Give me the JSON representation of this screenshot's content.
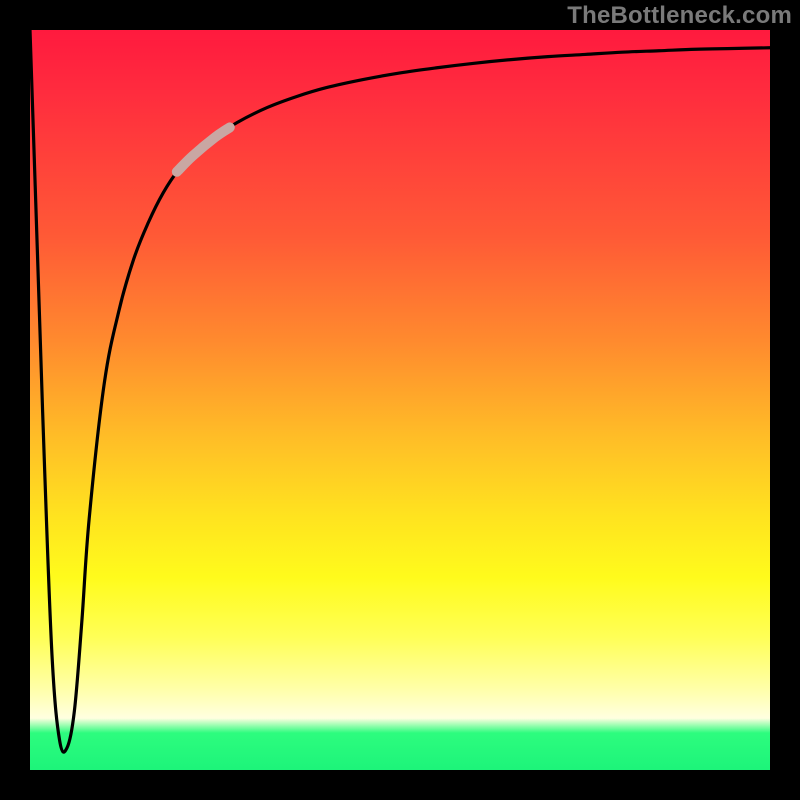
{
  "watermark": "TheBottleneck.com",
  "chart_data": {
    "type": "line",
    "title": "",
    "xlabel": "",
    "ylabel": "",
    "xlim": [
      0,
      100
    ],
    "ylim": [
      0,
      100
    ],
    "grid": false,
    "legend": false,
    "annotations": [],
    "highlight_segment": {
      "x_start": 20,
      "x_end": 27,
      "note": "pale overlay on curve"
    },
    "background_gradient": {
      "direction": "vertical",
      "stops": [
        {
          "pos": 0.0,
          "color": "#ff1a3e"
        },
        {
          "pos": 0.28,
          "color": "#ff5a36"
        },
        {
          "pos": 0.55,
          "color": "#ffbd27"
        },
        {
          "pos": 0.74,
          "color": "#fffb1c"
        },
        {
          "pos": 0.92,
          "color": "#ffffe0"
        },
        {
          "pos": 0.96,
          "color": "#2dfc7e"
        },
        {
          "pos": 1.0,
          "color": "#1df47a"
        }
      ]
    },
    "series": [
      {
        "name": "curve",
        "x": [
          0,
          1,
          2,
          3,
          4,
          5,
          6,
          7,
          8,
          10,
          12,
          14,
          16,
          18,
          20,
          22,
          25,
          28,
          32,
          36,
          40,
          45,
          50,
          55,
          60,
          65,
          70,
          75,
          80,
          85,
          90,
          95,
          100
        ],
        "y": [
          100,
          70,
          40,
          15,
          4,
          3,
          8,
          20,
          34,
          52,
          62,
          69,
          74,
          78,
          81,
          83,
          85.5,
          87.5,
          89.5,
          91,
          92.2,
          93.3,
          94.2,
          94.9,
          95.5,
          96.0,
          96.4,
          96.7,
          97.0,
          97.2,
          97.4,
          97.5,
          97.6
        ]
      }
    ]
  }
}
